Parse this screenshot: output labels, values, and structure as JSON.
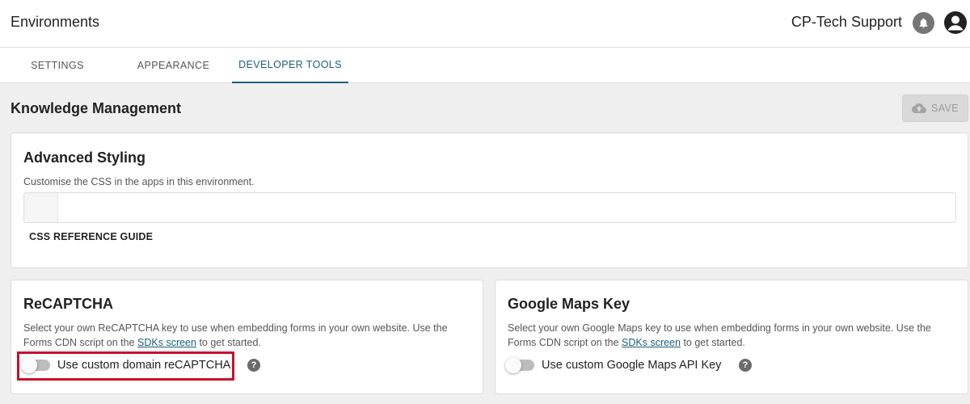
{
  "header": {
    "title": "Environments",
    "user_name": "CP-Tech Support",
    "bell_icon": "bell-icon",
    "avatar_icon": "account-circle-icon"
  },
  "tabs": [
    {
      "label": "SETTINGS",
      "active": false
    },
    {
      "label": "APPEARANCE",
      "active": false
    },
    {
      "label": "DEVELOPER TOOLS",
      "active": true
    }
  ],
  "main": {
    "section_title": "Knowledge Management",
    "save_label": "SAVE",
    "save_icon": "cloud-upload-icon"
  },
  "advanced_styling": {
    "title": "Advanced Styling",
    "description": "Customise the CSS in the apps in this environment.",
    "css_value": "",
    "link_label": "CSS REFERENCE GUIDE"
  },
  "recaptcha": {
    "title": "ReCAPTCHA",
    "desc_part1": "Select your own ReCAPTCHA key to use when embedding forms in your own website. Use the Forms CDN script on the ",
    "desc_link": "SDKs screen",
    "desc_part2": " to get started.",
    "toggle_label": "Use custom domain reCAPTCHA",
    "toggle_on": false
  },
  "google_maps": {
    "title": "Google Maps Key",
    "desc_part1": "Select your own Google Maps key to use when embedding forms in your own website. Use the Forms CDN script on the ",
    "desc_link": "SDKs screen",
    "desc_part2": " to get started.",
    "toggle_label": "Use custom Google Maps API Key",
    "toggle_on": false
  },
  "colors": {
    "accent": "#1b5e7a",
    "highlight_border": "#c8102e",
    "background": "#efefef"
  }
}
